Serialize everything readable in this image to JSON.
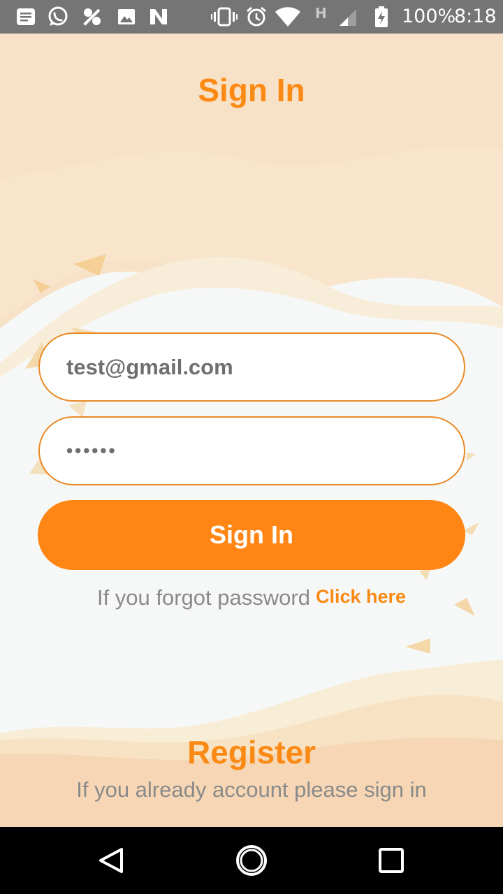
{
  "status_bar": {
    "battery_text": "100%",
    "time": "8:18",
    "network_label": "H",
    "left_icons": [
      "notes-icon",
      "whatsapp-icon",
      "percent-app-icon",
      "gallery-icon",
      "n-app-icon"
    ],
    "right_icons": [
      "vibrate-icon",
      "alarm-icon",
      "wifi-icon",
      "signal-icon",
      "battery-icon"
    ]
  },
  "header": {
    "title": "Sign In"
  },
  "form": {
    "email_value": "test@gmail.com",
    "password_value": "••••••",
    "signin_label": "Sign In",
    "forgot_text": "If you forgot password",
    "forgot_link": "Click here"
  },
  "footer": {
    "register_label": "Register",
    "register_sub": "If you already account please sign in"
  },
  "nav_bar": {
    "buttons": [
      "back-icon",
      "home-icon",
      "recents-icon"
    ]
  },
  "colors": {
    "accent": "#ff8614",
    "title_orange": "#fb8a15",
    "bg_peach": "#f7e0c6",
    "bg_cream": "#f8eddb",
    "bg_light": "#f6f8f8",
    "status_bar": "#757575",
    "text_gray": "#8a8a8a"
  }
}
